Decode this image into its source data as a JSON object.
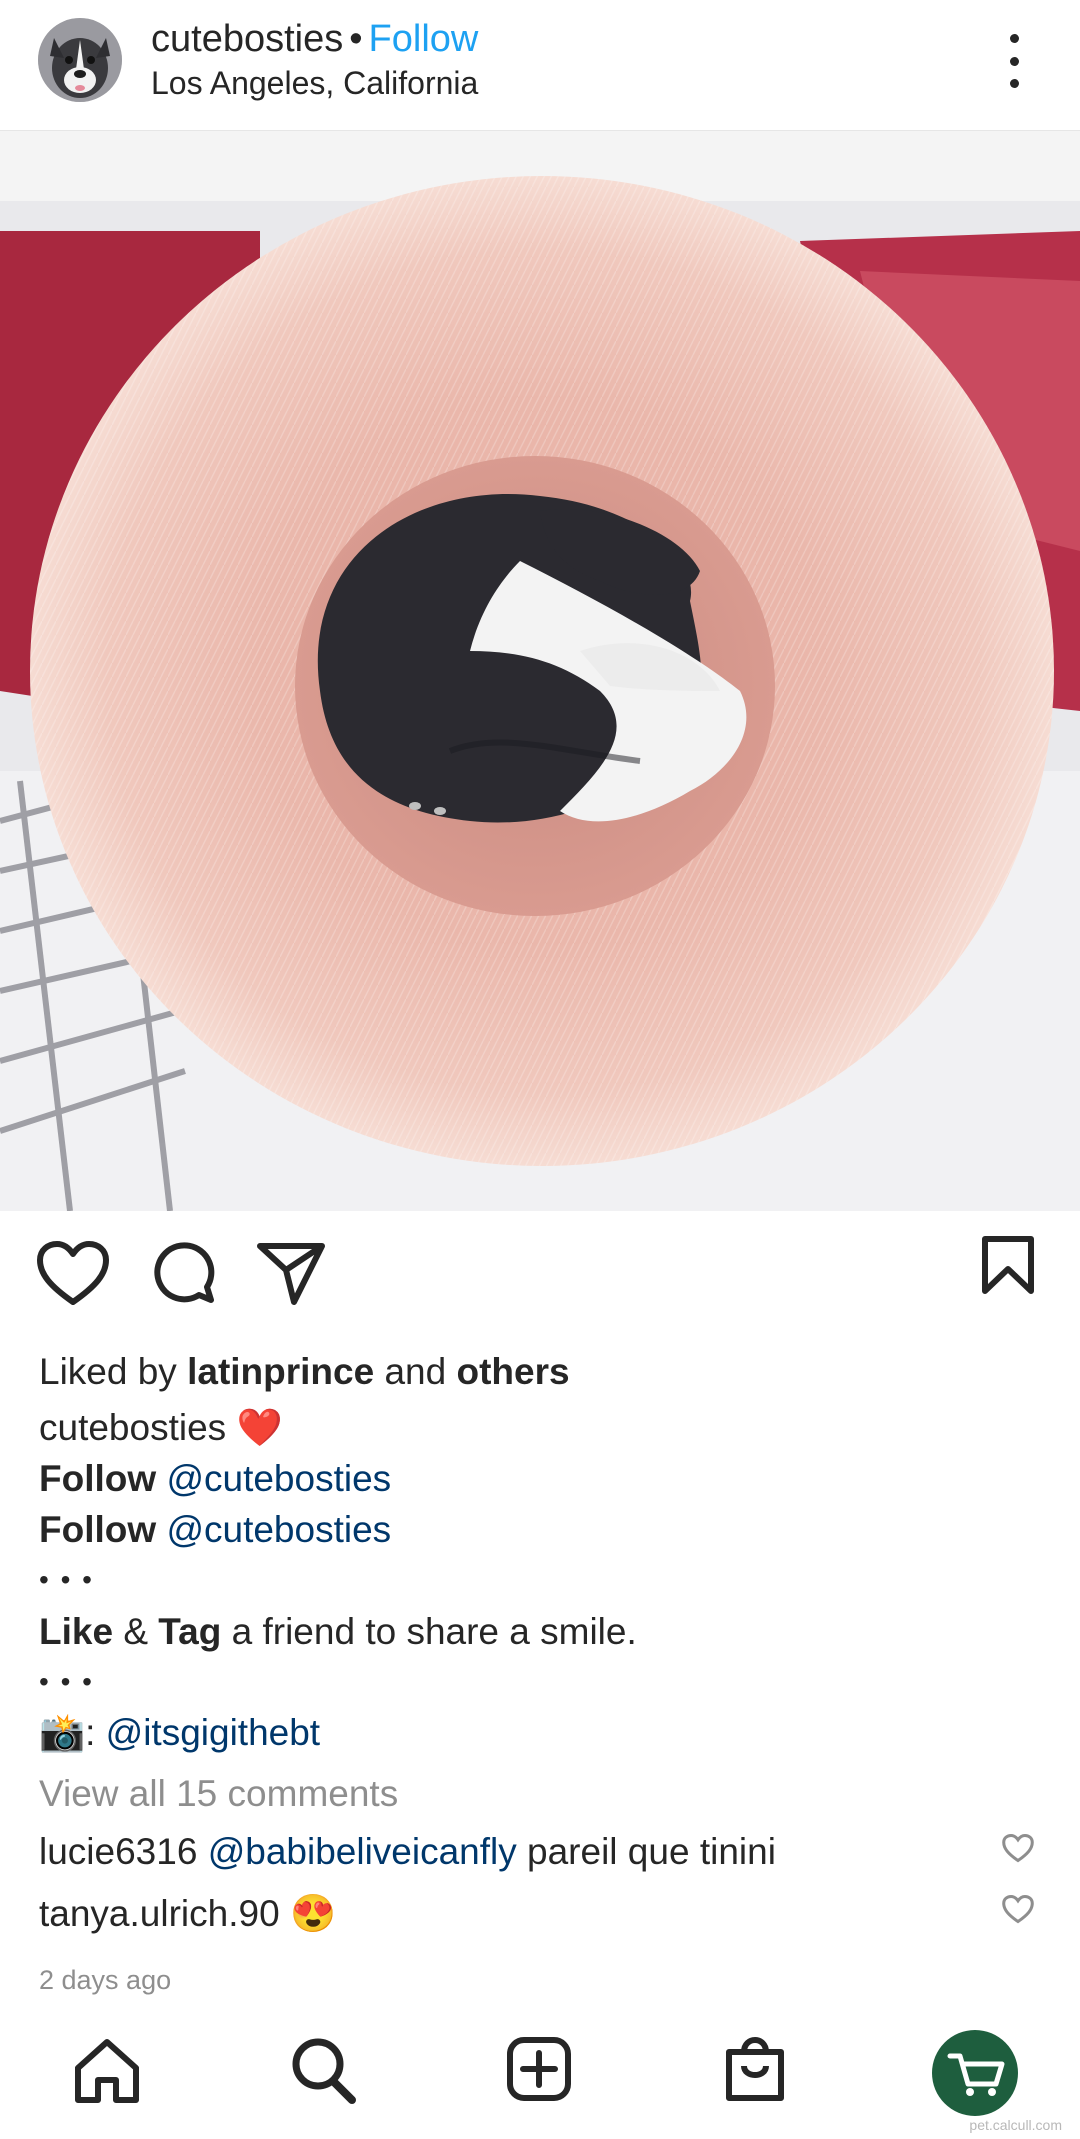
{
  "header": {
    "username": "cutebosties",
    "separator": "•",
    "follow_label": "Follow",
    "location": "Los Angeles, California"
  },
  "icons": {
    "avatar": "dog-avatar",
    "more": "more-options-icon",
    "like": "heart-icon",
    "comment": "comment-icon",
    "share": "send-icon",
    "save": "bookmark-icon",
    "home": "home-icon",
    "search": "search-icon",
    "create": "add-post-icon",
    "shop": "shopping-bag-icon",
    "cart": "cart-icon"
  },
  "likes": {
    "prefix": "Liked by",
    "user": "latinprince",
    "middle": "and",
    "suffix": "others"
  },
  "caption": {
    "username": "cutebosties",
    "emoji": "❤️",
    "follow_word": "Follow",
    "mention1": "@cutebosties",
    "mention2": "@cutebosties",
    "dots": "• • •",
    "like_word": "Like",
    "amp": "&",
    "tag_word": "Tag",
    "rest": "a friend to share a smile.",
    "camera": "📸",
    "colon": ":",
    "photo_credit": "@itsgigithebt"
  },
  "comments": {
    "view_all": "View all 15 comments",
    "items": [
      {
        "user": "lucie6316",
        "mention": "@babibeliveicanfly",
        "text": "pareil que tinini"
      },
      {
        "user": "tanya.ulrich.90",
        "mention": "",
        "text": "😍"
      }
    ]
  },
  "timestamp": "2 days ago",
  "watermark": "pet.calcull.com",
  "colors": {
    "follow": "#1da1f2",
    "mention": "#00376b",
    "muted": "#8e8e8e",
    "cart_button": "#1e5e3e",
    "heart_emoji": "#e0202e"
  }
}
